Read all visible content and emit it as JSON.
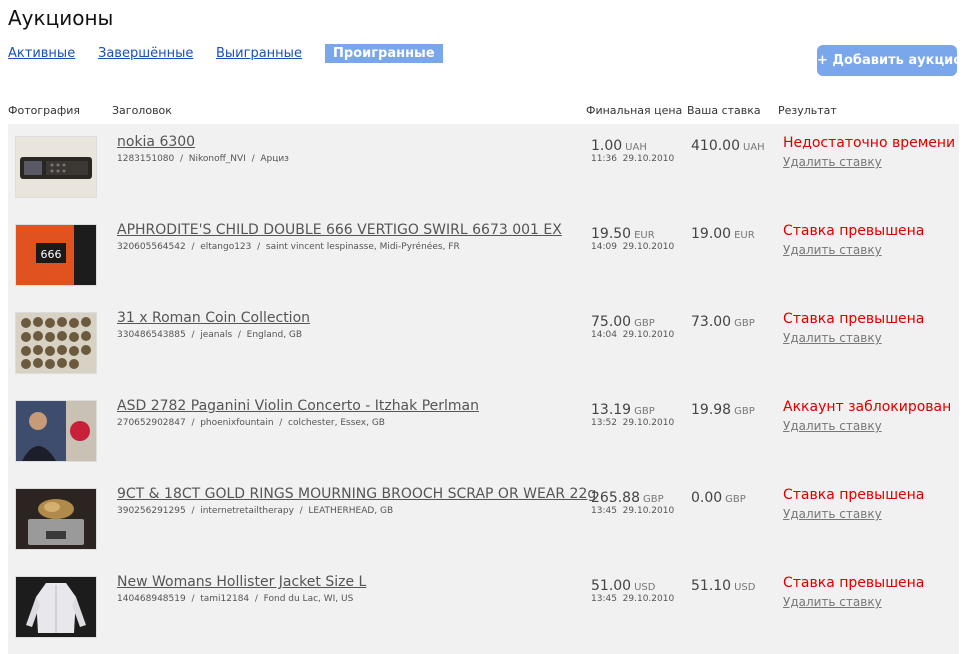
{
  "page_title": "Аукционы",
  "tabs": [
    {
      "label": "Активные",
      "active": false
    },
    {
      "label": "Завершённые",
      "active": false
    },
    {
      "label": "Выигранные",
      "active": false
    },
    {
      "label": "Проигранные",
      "active": true
    }
  ],
  "add_button": "+ Добавить аукцион",
  "columns": [
    "Фотография",
    "Заголовок",
    "Финальная цена",
    "Ваша ставка",
    "Результат"
  ],
  "colors": {
    "accent": "#7aa6ec",
    "link": "#1a4fb8",
    "error": "#d90000",
    "row_bg": "#f1f1f1"
  },
  "rows": [
    {
      "title": "nokia 6300",
      "id": "1283151080",
      "seller": "Nikonoff_NVI",
      "location": "Арциз",
      "final_price": "1.00",
      "final_currency": "UAH",
      "time": "11:36",
      "date": "29.10.2010",
      "bid": "410.00",
      "bid_currency": "UAH",
      "result": "Недостаточно времени",
      "remove": "Удалить ставку",
      "photo": "phone"
    },
    {
      "title": "APHRODITE'S CHILD DOUBLE 666 VERTIGO SWIRL 6673 001 EX",
      "id": "320605564542",
      "seller": "eltango123",
      "location": "saint vincent lespinasse, Midi-Pyrénées, FR",
      "final_price": "19.50",
      "final_currency": "EUR",
      "time": "14:09",
      "date": "29.10.2010",
      "bid": "19.00",
      "bid_currency": "EUR",
      "result": "Ставка превышена",
      "remove": "Удалить ставку",
      "photo": "record-666"
    },
    {
      "title": "31 x Roman Coin Collection",
      "id": "330486543885",
      "seller": "jeanals",
      "location": "England, GB",
      "final_price": "75.00",
      "final_currency": "GBP",
      "time": "14:04",
      "date": "29.10.2010",
      "bid": "73.00",
      "bid_currency": "GBP",
      "result": "Ставка превышена",
      "remove": "Удалить ставку",
      "photo": "coins"
    },
    {
      "title": "ASD 2782 Paganini Violin Concerto - Itzhak Perlman",
      "id": "270652902847",
      "seller": "phoenixfountain",
      "location": "colchester, Essex, GB",
      "final_price": "13.19",
      "final_currency": "GBP",
      "time": "13:52",
      "date": "29.10.2010",
      "bid": "19.98",
      "bid_currency": "GBP",
      "result": "Аккаунт заблокирован",
      "remove": "Удалить ставку",
      "photo": "album"
    },
    {
      "title": "9CT & 18CT GOLD RINGS MOURNING BROOCH SCRAP OR WEAR 22g",
      "id": "390256291295",
      "seller": "internetretailtherapy",
      "location": "LEATHERHEAD, GB",
      "final_price": "265.88",
      "final_currency": "GBP",
      "time": "13:45",
      "date": "29.10.2010",
      "bid": "0.00",
      "bid_currency": "GBP",
      "result": "Ставка превышена",
      "remove": "Удалить ставку",
      "photo": "scale"
    },
    {
      "title": "New Womans Hollister Jacket Size L",
      "id": "140468948519",
      "seller": "tami12184",
      "location": "Fond du Lac, WI, US",
      "final_price": "51.00",
      "final_currency": "USD",
      "time": "13:45",
      "date": "29.10.2010",
      "bid": "51.10",
      "bid_currency": "USD",
      "result": "Ставка превышена",
      "remove": "Удалить ставку",
      "photo": "jacket"
    }
  ]
}
